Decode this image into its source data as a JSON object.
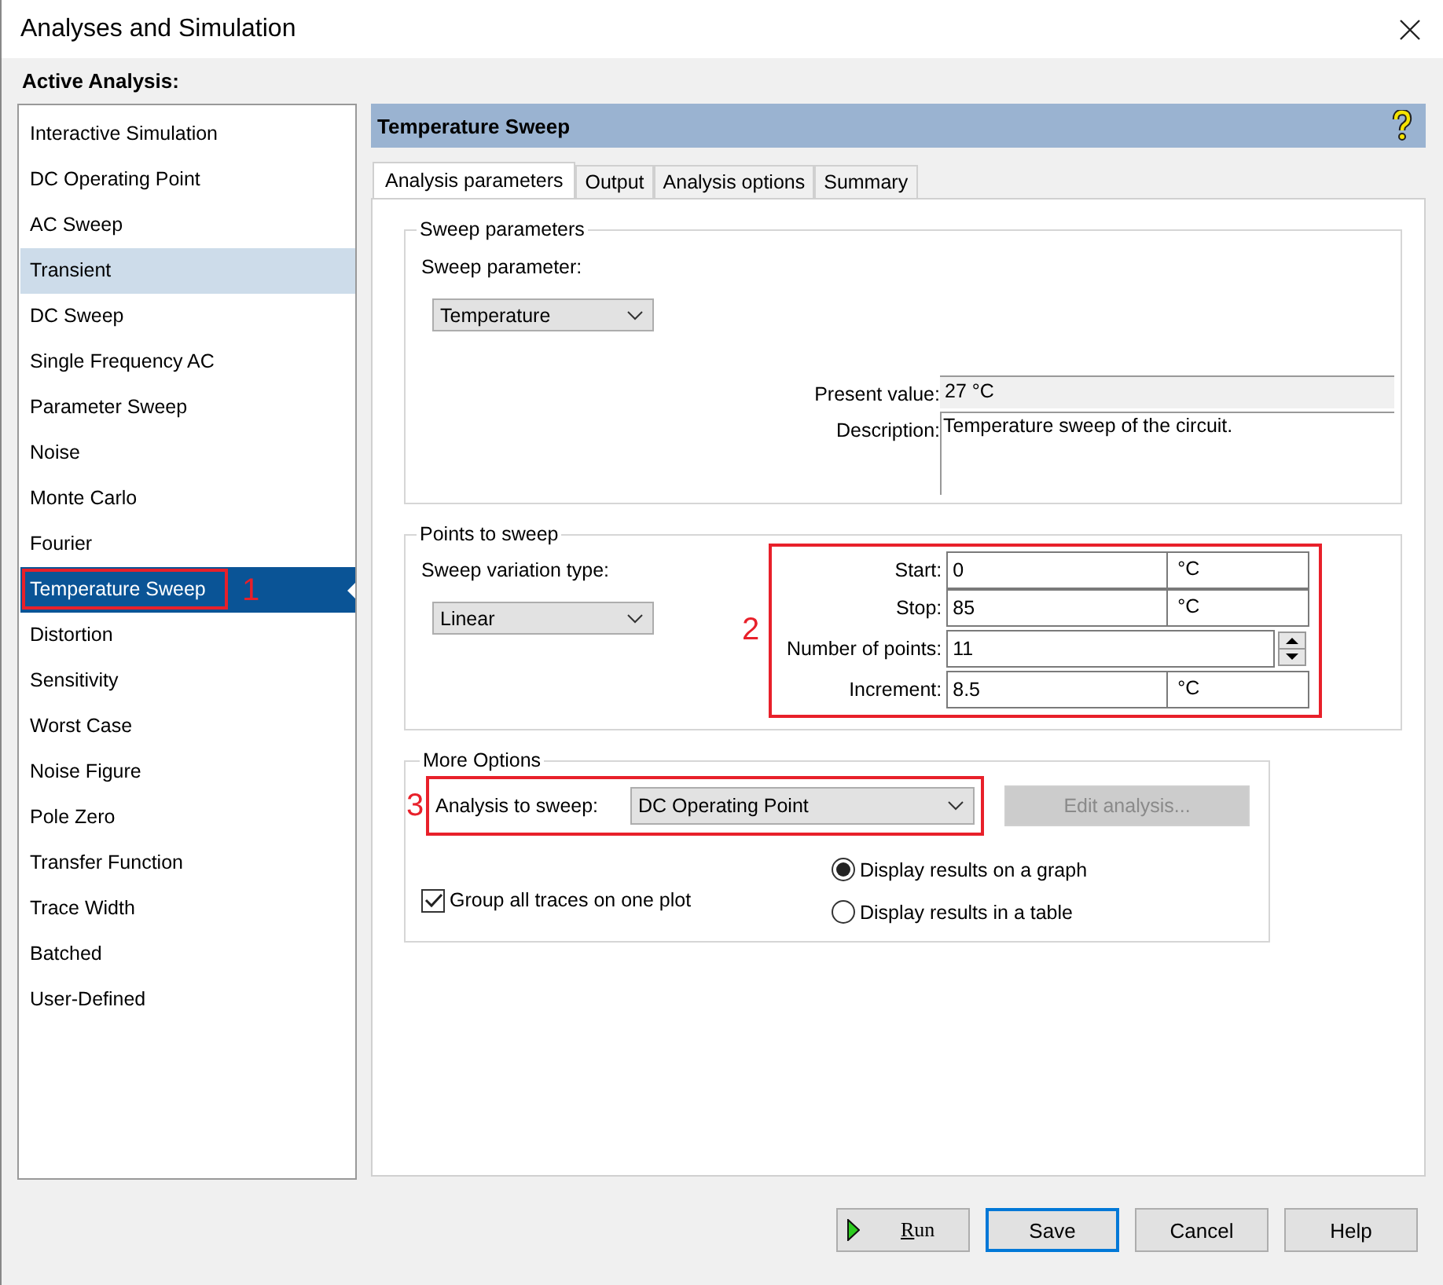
{
  "window": {
    "title": "Analyses and Simulation"
  },
  "sidebar": {
    "heading": "Active Analysis:",
    "items": [
      {
        "label": "Interactive Simulation",
        "selected": false,
        "highlighted": false
      },
      {
        "label": "DC Operating Point",
        "selected": false,
        "highlighted": false
      },
      {
        "label": "AC Sweep",
        "selected": false,
        "highlighted": false
      },
      {
        "label": "Transient",
        "selected": false,
        "highlighted": true
      },
      {
        "label": "DC Sweep",
        "selected": false,
        "highlighted": false
      },
      {
        "label": "Single Frequency AC",
        "selected": false,
        "highlighted": false
      },
      {
        "label": "Parameter Sweep",
        "selected": false,
        "highlighted": false
      },
      {
        "label": "Noise",
        "selected": false,
        "highlighted": false
      },
      {
        "label": "Monte Carlo",
        "selected": false,
        "highlighted": false
      },
      {
        "label": "Fourier",
        "selected": false,
        "highlighted": false
      },
      {
        "label": "Temperature Sweep",
        "selected": true,
        "highlighted": false,
        "callout": "1"
      },
      {
        "label": "Distortion",
        "selected": false,
        "highlighted": false
      },
      {
        "label": "Sensitivity",
        "selected": false,
        "highlighted": false
      },
      {
        "label": "Worst Case",
        "selected": false,
        "highlighted": false
      },
      {
        "label": "Noise Figure",
        "selected": false,
        "highlighted": false
      },
      {
        "label": "Pole Zero",
        "selected": false,
        "highlighted": false
      },
      {
        "label": "Transfer Function",
        "selected": false,
        "highlighted": false
      },
      {
        "label": "Trace Width",
        "selected": false,
        "highlighted": false
      },
      {
        "label": "Batched",
        "selected": false,
        "highlighted": false
      },
      {
        "label": "User-Defined",
        "selected": false,
        "highlighted": false
      }
    ]
  },
  "panel": {
    "title": "Temperature Sweep",
    "tabs": [
      {
        "label": "Analysis parameters",
        "selected": true
      },
      {
        "label": "Output",
        "selected": false
      },
      {
        "label": "Analysis options",
        "selected": false
      },
      {
        "label": "Summary",
        "selected": false
      }
    ],
    "sweep_parameters": {
      "legend": "Sweep parameters",
      "parameter_label": "Sweep parameter:",
      "parameter": "Temperature",
      "present_value_label": "Present value:",
      "present_value": "27 °C",
      "description_label": "Description:",
      "description": "Temperature sweep of the circuit."
    },
    "points": {
      "legend": "Points to sweep",
      "variation_label": "Sweep variation type:",
      "variation": "Linear",
      "callout": "2",
      "fields": [
        {
          "kind": "unit",
          "label": "Start:",
          "value": "0",
          "unit": "°C"
        },
        {
          "kind": "unit",
          "label": "Stop:",
          "value": "85",
          "unit": "°C"
        },
        {
          "kind": "spinner",
          "label": "Number of points:",
          "value": "11"
        },
        {
          "kind": "unit",
          "label": "Increment:",
          "value": "8.5",
          "unit": "°C"
        }
      ]
    },
    "more_options": {
      "legend": "More Options",
      "callout": "3",
      "analysis_label": "Analysis to sweep:",
      "analysis": "DC Operating Point",
      "edit_button": {
        "label": "Edit analysis...",
        "disabled": true
      },
      "group_traces": {
        "label": "Group all traces on one plot",
        "checked": true
      },
      "display": [
        {
          "label": "Display results on a graph",
          "selected": true
        },
        {
          "label": "Display results in a table",
          "selected": false
        }
      ]
    }
  },
  "buttons": [
    {
      "kind": "run",
      "label": "Run",
      "default": false
    },
    {
      "kind": "plain",
      "label": "Save",
      "default": true
    },
    {
      "kind": "plain",
      "label": "Cancel",
      "default": false
    },
    {
      "kind": "plain",
      "label": "Help",
      "default": false
    }
  ]
}
